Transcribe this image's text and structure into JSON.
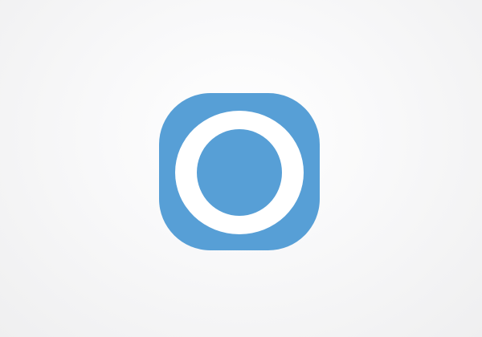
{
  "app_icon": {
    "icon": "circle-ring-icon",
    "background_color": "#579fd6",
    "ring_color": "#ffffff",
    "core_color": "#579fd6"
  },
  "page": {
    "background_color": "#f3f3f4"
  }
}
